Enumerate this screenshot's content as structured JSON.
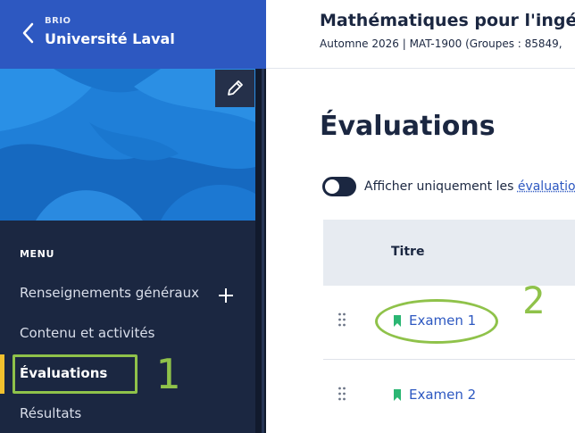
{
  "brand": {
    "sub": "BRIO",
    "title": "Université Laval"
  },
  "sidebar": {
    "menu_heading": "MENU",
    "items": [
      {
        "label": "Renseignements généraux"
      },
      {
        "label": "Contenu et activités"
      },
      {
        "label": "Évaluations"
      },
      {
        "label": "Résultats"
      }
    ]
  },
  "header": {
    "course_title": "Mathématiques pour l'ingén",
    "course_meta": "Automne 2026 | MAT-1900 (Groupes : 85849,"
  },
  "main": {
    "page_title": "Évaluations",
    "toggle_text": "Afficher uniquement les ",
    "toggle_link": "évaluations",
    "table": {
      "header_title": "Titre",
      "rows": [
        {
          "title": "Examen 1"
        },
        {
          "title": "Examen 2"
        }
      ]
    }
  },
  "annotations": {
    "one": "1",
    "two": "2"
  },
  "colors": {
    "sidebar_bg": "#1b2741",
    "brand_bg": "#2d58c1",
    "accent_link": "#2d58c1",
    "active_bar": "#f2c12e",
    "annotation": "#8fc24a",
    "bookmark": "#2bb673"
  }
}
